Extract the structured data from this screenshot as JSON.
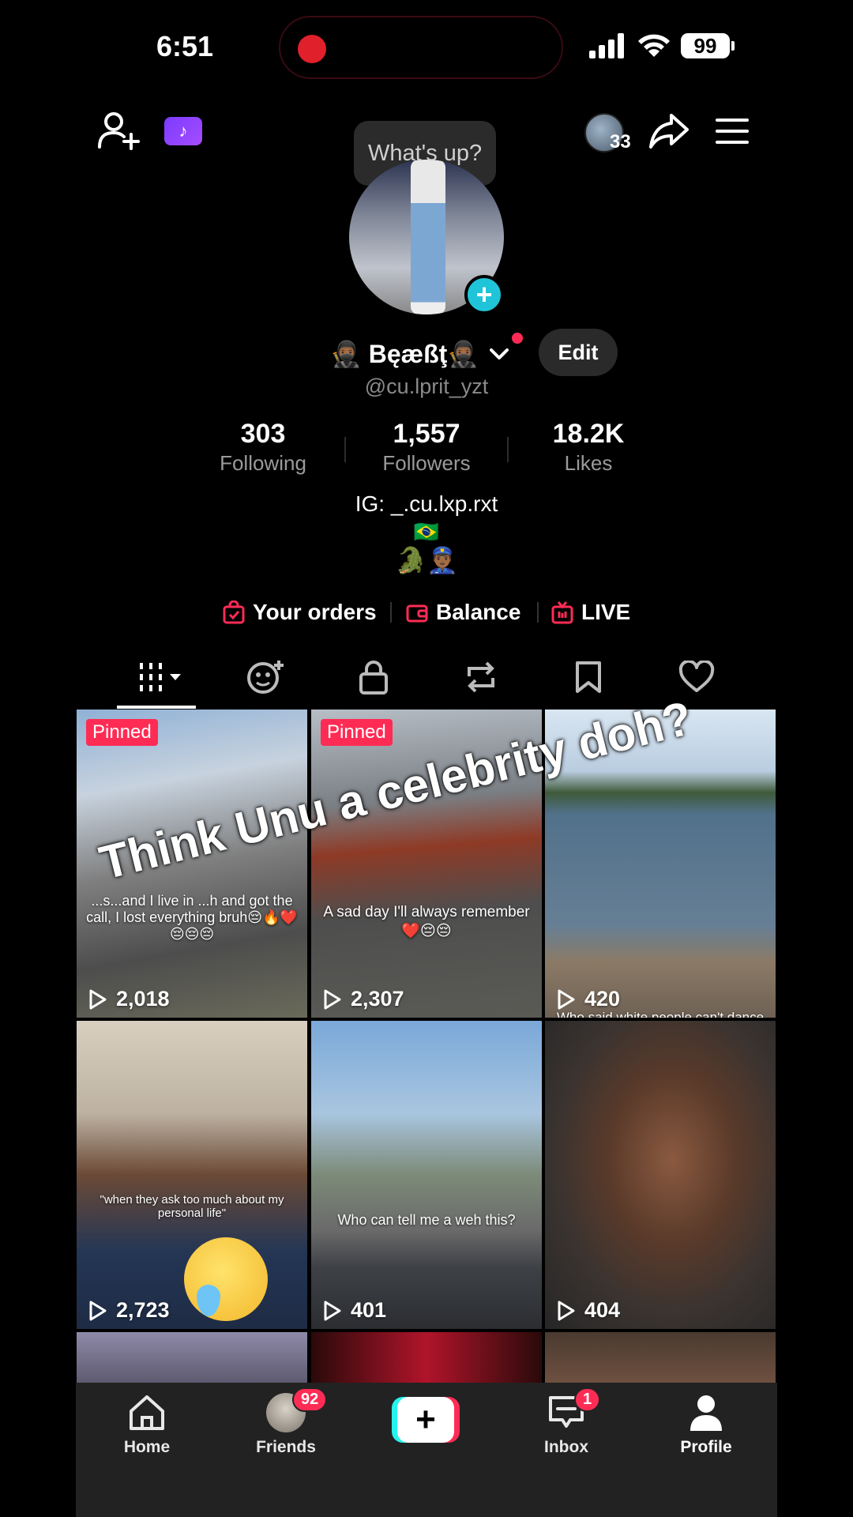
{
  "status_bar": {
    "time": "6:51",
    "battery": "99"
  },
  "top": {
    "whats_up": "What's up?",
    "friends_count": "33"
  },
  "profile": {
    "name": "🥷🏾 Bęæßţ🥷🏾",
    "handle": "@cu.lprit_yzt",
    "edit_label": "Edit",
    "stats": [
      {
        "value": "303",
        "label": "Following"
      },
      {
        "value": "1,557",
        "label": "Followers"
      },
      {
        "value": "18.2K",
        "label": "Likes"
      }
    ],
    "bio_lines": [
      "IG: _.cu.lxp.rxt",
      "🇧🇷",
      "🐊👮🏾‍♂️"
    ]
  },
  "quick_links": [
    {
      "label": "Your orders",
      "icon": "bag-icon"
    },
    {
      "label": "Balance",
      "icon": "wallet-icon"
    },
    {
      "label": "LIVE",
      "icon": "tv-icon"
    }
  ],
  "tabs": [
    {
      "name": "videos-grid-icon",
      "active": true
    },
    {
      "name": "reposts-emoji-icon"
    },
    {
      "name": "lock-icon"
    },
    {
      "name": "repost-icon"
    },
    {
      "name": "bookmark-icon"
    },
    {
      "name": "heart-icon"
    }
  ],
  "overlay_text": "Think Unu a celebrity doh?",
  "videos": [
    {
      "pinned": "Pinned",
      "views": "2,018",
      "caption": "...s...and I live in ...h and got the call, I lost everything bruh😔🔥❤️😔😔😔"
    },
    {
      "pinned": "Pinned",
      "views": "2,307",
      "caption": "A sad day I'll always remember ❤️😔😔"
    },
    {
      "views": "420",
      "caption": "Who said white people can't dance"
    },
    {
      "views": "2,723",
      "caption": "\"when they ask too much about my personal life\""
    },
    {
      "views": "401",
      "caption": "Who can tell me a weh this?"
    },
    {
      "views": "404",
      "caption": ""
    }
  ],
  "bottom_nav": {
    "home": "Home",
    "friends": "Friends",
    "friends_badge": "92",
    "inbox": "Inbox",
    "inbox_badge": "1",
    "profile": "Profile"
  }
}
